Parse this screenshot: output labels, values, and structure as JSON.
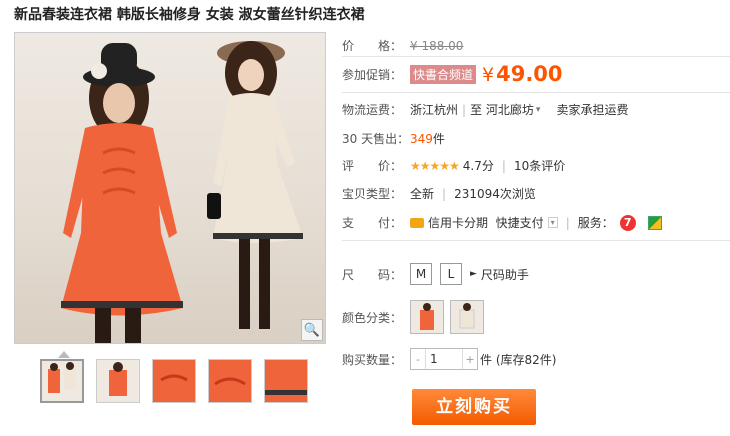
{
  "product": {
    "title": "新品春装连衣裙 韩版长袖修身 女装 淑女蕾丝针织连衣裙"
  },
  "price": {
    "label": "价　　格：",
    "original": "¥ 188.00",
    "promo_label": "参加促销：",
    "promo_tag": "快書合频道",
    "currency": "¥",
    "current": "49.00"
  },
  "shipping": {
    "label": "物流运费：",
    "from": "浙江杭州",
    "to_prefix": "至",
    "to": "河北廊坊",
    "fee": "卖家承担运费"
  },
  "sales": {
    "label": "30 天售出：",
    "count": "349",
    "unit": "件"
  },
  "rating": {
    "label": "评　　价：",
    "stars": "★★★★★",
    "score": "4.7分",
    "reviews": "10条评价"
  },
  "item_type": {
    "label": "宝贝类型：",
    "condition": "全新",
    "views": "231094次浏览"
  },
  "payment": {
    "label": "支　　付：",
    "credit": "信用卡分期",
    "quick": "快捷支付",
    "service_label": "服务：",
    "service_icon_text": "7"
  },
  "size": {
    "label": "尺　　码：",
    "options": [
      "M",
      "L"
    ],
    "helper": "尺码助手"
  },
  "color": {
    "label": "颜色分类："
  },
  "quantity": {
    "label": "购买数量：",
    "minus": "-",
    "value": "1",
    "plus": "+",
    "stock": "件 (库存82件)"
  },
  "buy_button": "立刻购买",
  "colors": {
    "orange_dress": "#f0643c",
    "cream_dress": "#efe6d8",
    "price": "#ff5500",
    "buy_button": "#f35b00"
  },
  "icons": {
    "zoom": "magnifier-icon",
    "dropdown": "chevron-down-icon",
    "card": "credit-card-icon"
  }
}
